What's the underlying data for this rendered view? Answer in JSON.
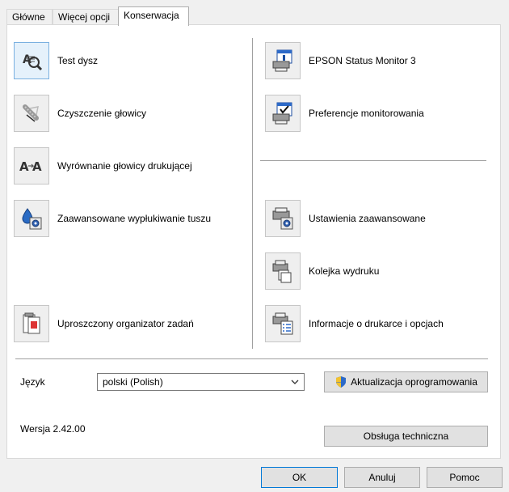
{
  "tabs": [
    {
      "label": "Główne"
    },
    {
      "label": "Więcej opcji"
    },
    {
      "label": "Konserwacja"
    }
  ],
  "left_items": [
    {
      "label": "Test dysz",
      "icon": "nozzle-check-icon"
    },
    {
      "label": "Czyszczenie głowicy",
      "icon": "head-cleaning-icon"
    },
    {
      "label": "Wyrównanie głowicy drukującej",
      "icon": "head-alignment-icon"
    },
    {
      "label": "Zaawansowane wypłukiwanie tuszu",
      "icon": "ink-flush-icon"
    },
    {
      "label": "Uproszczony organizator zadań",
      "icon": "job-arranger-icon"
    }
  ],
  "right_items": [
    {
      "label": "EPSON Status Monitor 3",
      "icon": "status-monitor-icon"
    },
    {
      "label": "Preferencje monitorowania",
      "icon": "monitoring-preferences-icon"
    },
    {
      "label": "Ustawienia zaawansowane",
      "icon": "extended-settings-icon"
    },
    {
      "label": "Kolejka wydruku",
      "icon": "print-queue-icon"
    },
    {
      "label": "Informacje o drukarce i opcjach",
      "icon": "printer-info-icon"
    }
  ],
  "language": {
    "label": "Język",
    "value": "polski (Polish)"
  },
  "software_update_label": "Aktualizacja oprogramowania",
  "version": "Wersja 2.42.00",
  "tech_support_label": "Obsługa techniczna",
  "footer": {
    "ok": "OK",
    "cancel": "Anuluj",
    "help": "Pomoc"
  }
}
